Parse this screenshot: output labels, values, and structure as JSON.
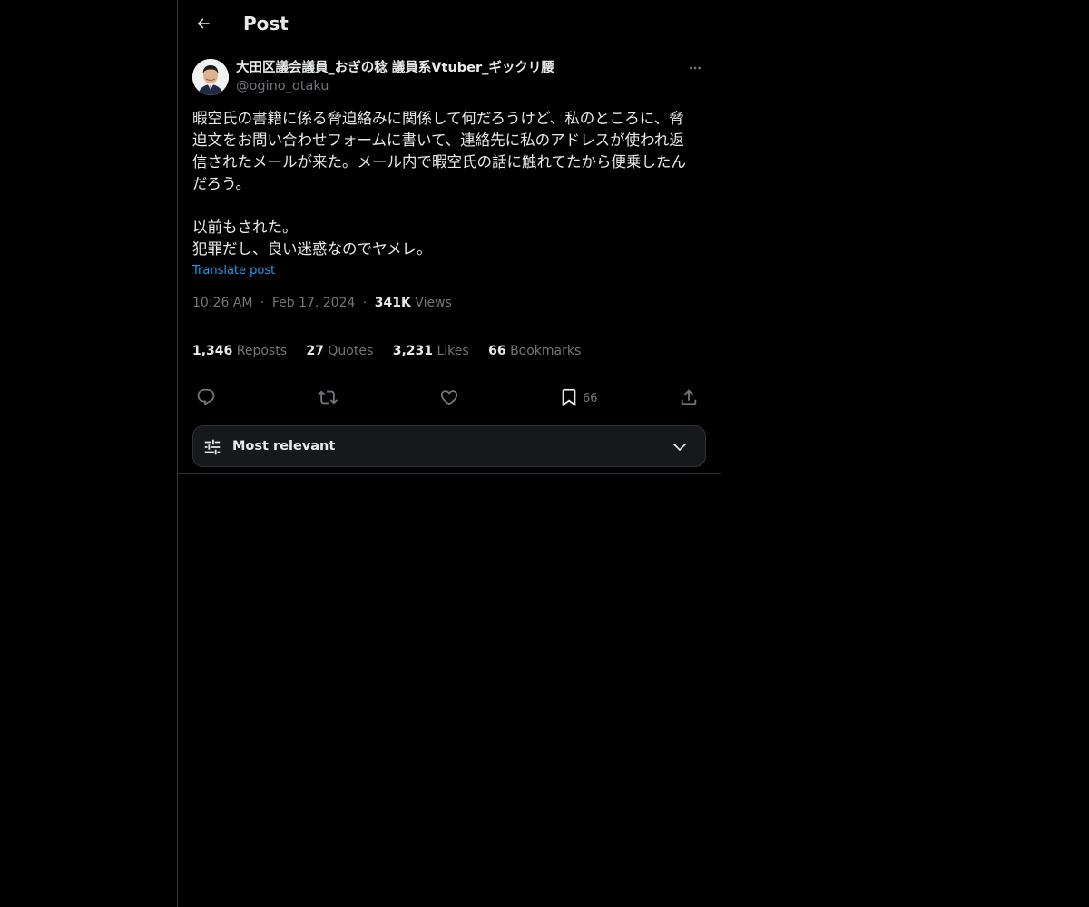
{
  "header": {
    "title": "Post",
    "back_icon": "arrow-left-icon"
  },
  "author": {
    "display_name": "大田区議会議員_おぎの稔 議員系Vtuber_ギックリ腰",
    "handle": "@ogino_otaku",
    "more_icon": "more-horizontal-icon"
  },
  "post": {
    "text": "暇空氏の書籍に係る脅迫絡みに関係して何だろうけど、私のところに、脅\n迫文をお問い合わせフォームに書いて、連絡先に私のアドレスが使われ返\n信されたメールが来た。メール内で暇空氏の話に触れてたから便乗したん\nだろう。\n\n以前もされた。\n犯罪だし、良い迷惑なのでヤメレ。",
    "translate_label": "Translate post"
  },
  "meta": {
    "time": "10:26 AM",
    "sep1": "·",
    "date": "Feb 17, 2024",
    "sep2": "·",
    "views_count": "341K",
    "views_label": "Views"
  },
  "stats": {
    "reposts_count": "1,346",
    "reposts_label": "Reposts",
    "quotes_count": "27",
    "quotes_label": "Quotes",
    "likes_count": "3,231",
    "likes_label": "Likes",
    "bookmarks_count": "66",
    "bookmarks_label": "Bookmarks"
  },
  "actions": {
    "reply_icon": "reply-icon",
    "repost_icon": "repost-icon",
    "like_icon": "heart-icon",
    "bookmark_icon": "bookmark-icon",
    "bookmark_count": "66",
    "share_icon": "share-icon"
  },
  "sort": {
    "label": "Most relevant",
    "icon": "sliders-icon",
    "chevron": "chevron-down-icon"
  },
  "colors": {
    "background": "#000000",
    "text_primary": "#e7e9ea",
    "text_secondary": "#71767b",
    "link": "#1d9bf0",
    "border": "#2f3336"
  }
}
